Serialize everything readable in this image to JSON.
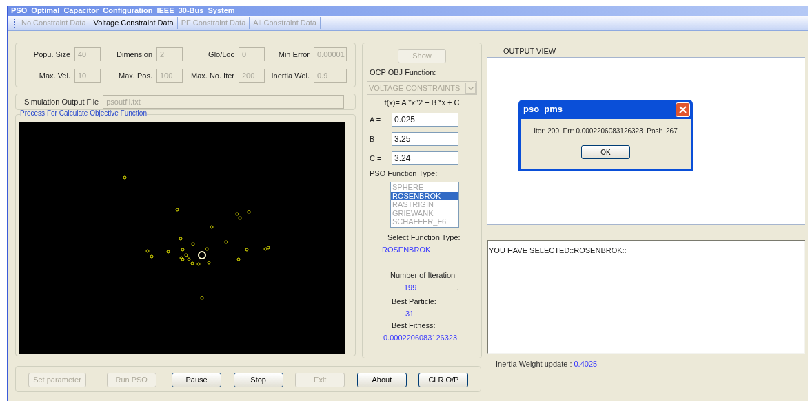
{
  "window": {
    "title": "PSO_Optimal_Capacitor_Configuration_IEEE_30-Bus_System"
  },
  "toolbar": [
    {
      "label": "No Constraint Data",
      "disabled": true
    },
    {
      "label": "Voltage Constraint Data",
      "disabled": false
    },
    {
      "label": "PF Constraint Data",
      "disabled": true
    },
    {
      "label": "All Constraint Data",
      "disabled": true
    }
  ],
  "parameters": [
    {
      "label": "Popu. Size",
      "value": "40",
      "disabled": true
    },
    {
      "label": "Dimension",
      "value": "2",
      "disabled": true
    },
    {
      "label": "Glo/Loc",
      "value": "0",
      "disabled": true
    },
    {
      "label": "Min Error",
      "value": "0.00001",
      "disabled": true
    },
    {
      "label": "Max. Vel.",
      "value": "10",
      "disabled": true
    },
    {
      "label": "Max. Pos.",
      "value": "100",
      "disabled": true
    },
    {
      "label": "Max. No. Iter",
      "value": "200",
      "disabled": true
    },
    {
      "label": "Inertia Wei.",
      "value": "0.9",
      "disabled": true
    }
  ],
  "output_file": {
    "label": "Simulation Output File",
    "value": "psoutfil.txt",
    "disabled": true
  },
  "process_group": {
    "title": "Process For Calculate Objective Function"
  },
  "middle": {
    "show_button": {
      "label": "Show",
      "disabled": true
    },
    "objective_label": "OCP OBJ Function:",
    "objective_select": {
      "value": "VOLTAGE CONSTRAINTS",
      "disabled": true
    },
    "formula": "f(x)= A *x^2 + B *x + C",
    "coefficients": [
      {
        "label": "A =",
        "value": "0.025"
      },
      {
        "label": "B =",
        "value": "3.25"
      },
      {
        "label": "C =",
        "value": "3.24"
      }
    ],
    "function_type_label": "PSO Function Type:",
    "function_types": [
      {
        "label": "SPHERE",
        "selected": false
      },
      {
        "label": "ROSENBROK",
        "selected": true
      },
      {
        "label": "RASTRIGIN",
        "selected": false
      },
      {
        "label": "GRIEWANK",
        "selected": false
      },
      {
        "label": "SCHAFFER_F6",
        "selected": false
      }
    ],
    "select_label": "Select Function Type:",
    "select_value": "ROSENBROK",
    "iteration_label": "Number of Iteration",
    "iteration_value": "199",
    "iteration_dot": ".",
    "particle_label": "Best Particle:",
    "particle_value": "31",
    "fitness_label": "Best Fitness:",
    "fitness_value": "0.0002206083126323"
  },
  "output_view": {
    "title": "OUTPUT VIEW"
  },
  "dialog": {
    "title": "pso_pms",
    "message": "Iter: 200  Err: 0.0002206083126323  Posi:  267",
    "button": "OK"
  },
  "log": {
    "text": "YOU HAVE SELECTED::ROSENBROK::"
  },
  "inertia_update": {
    "label": "Inertia Weight update :",
    "value": "0.4025"
  },
  "buttons": [
    {
      "label": "Set parameter",
      "disabled": true
    },
    {
      "label": "Run PSO",
      "disabled": true
    },
    {
      "label": "Pause",
      "disabled": false
    },
    {
      "label": "Stop",
      "disabled": false
    },
    {
      "label": "Exit",
      "disabled": true
    },
    {
      "label": "About",
      "disabled": false
    },
    {
      "label": "CLR O/P",
      "disabled": false
    }
  ]
}
